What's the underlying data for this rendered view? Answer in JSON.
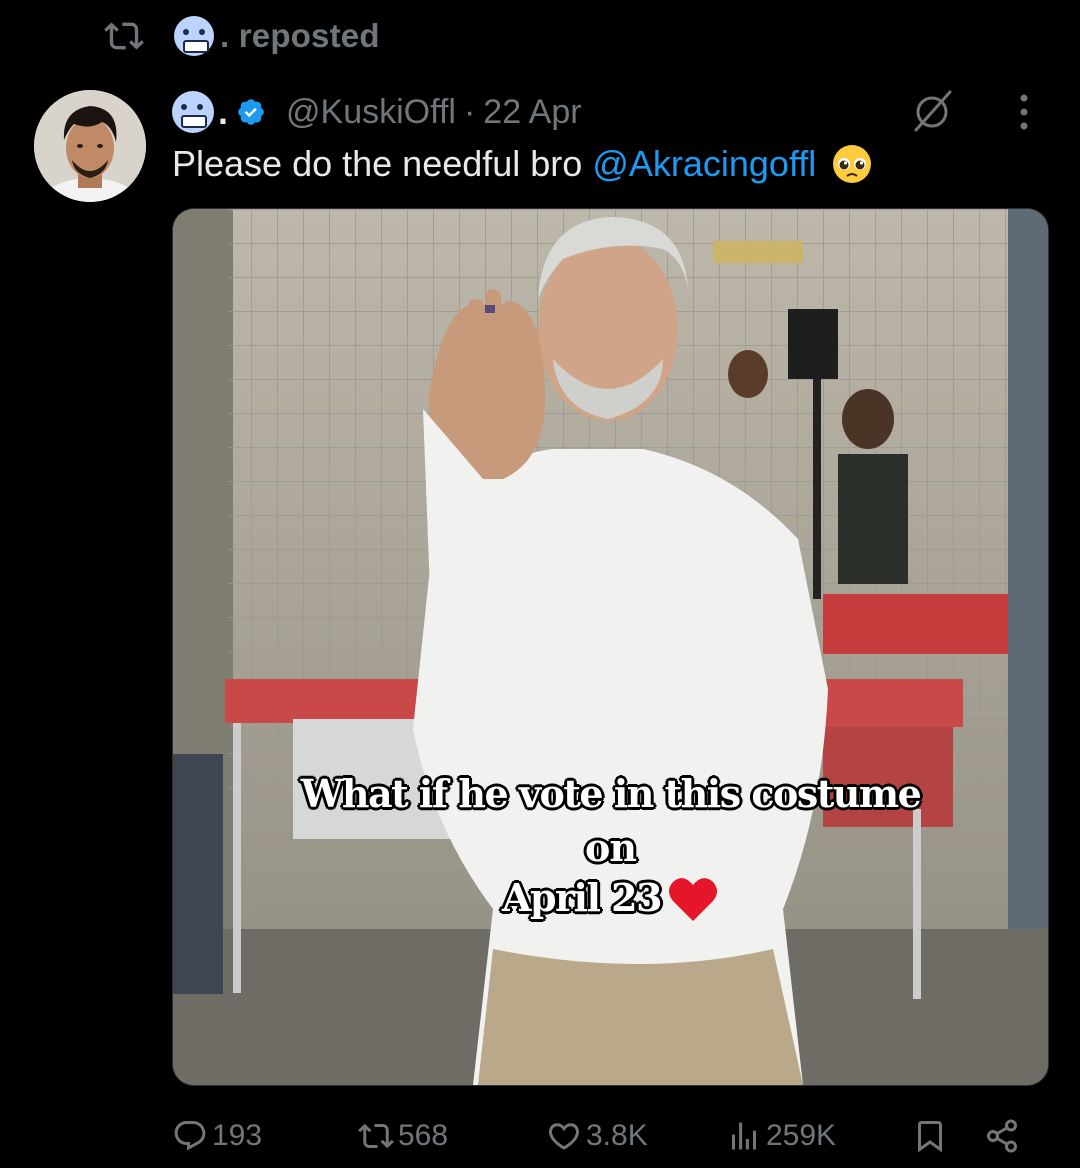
{
  "repost": {
    "label": ". reposted",
    "icon": "repost-icon",
    "user_emoji": "cold-face-emoji"
  },
  "tweet": {
    "author_emoji": "cold-face-emoji",
    "name_suffix": ".",
    "verified_icon": "verified-badge-icon",
    "handle": "@KuskiOffl",
    "separator": "·",
    "date": "22 Apr",
    "text": "Please do the needful bro",
    "mention": "@Akracingoffl",
    "trailing_emoji": "pleading-face-emoji",
    "header_icons": [
      "grok-icon",
      "more-icon"
    ]
  },
  "media": {
    "caption_line1": "What if he vote in this costume",
    "caption_line2": "on",
    "caption_line3": "April 23",
    "caption_emoji": "red-heart-emoji"
  },
  "actions": {
    "replies": "193",
    "reposts": "568",
    "likes": "3.8K",
    "views": "259K"
  },
  "colors": {
    "background": "#000000",
    "text": "#e7e9ea",
    "muted": "#71767b",
    "accent": "#1d9bf0"
  }
}
